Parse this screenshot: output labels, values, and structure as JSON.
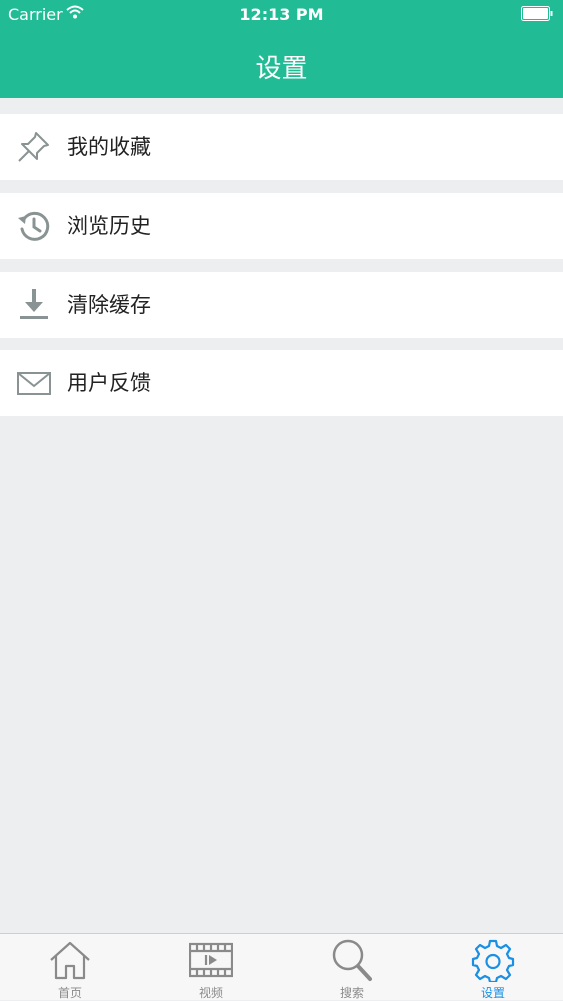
{
  "status_bar": {
    "carrier": "Carrier",
    "time": "12:13 PM"
  },
  "nav": {
    "title": "设置"
  },
  "menu": {
    "items": [
      {
        "label": "我的收藏",
        "icon": "pin-icon"
      },
      {
        "label": "浏览历史",
        "icon": "history-icon"
      },
      {
        "label": "清除缓存",
        "icon": "download-icon"
      },
      {
        "label": "用户反馈",
        "icon": "mail-icon"
      }
    ]
  },
  "tabbar": {
    "items": [
      {
        "label": "首页",
        "icon": "home-icon"
      },
      {
        "label": "视频",
        "icon": "film-icon"
      },
      {
        "label": "搜索",
        "icon": "search-icon"
      },
      {
        "label": "设置",
        "icon": "gear-icon",
        "active": true
      }
    ]
  },
  "colors": {
    "accent": "#21bc95",
    "background": "#eceeef",
    "tab_active": "#1a8fe3",
    "icon_gray": "#8a9393"
  }
}
